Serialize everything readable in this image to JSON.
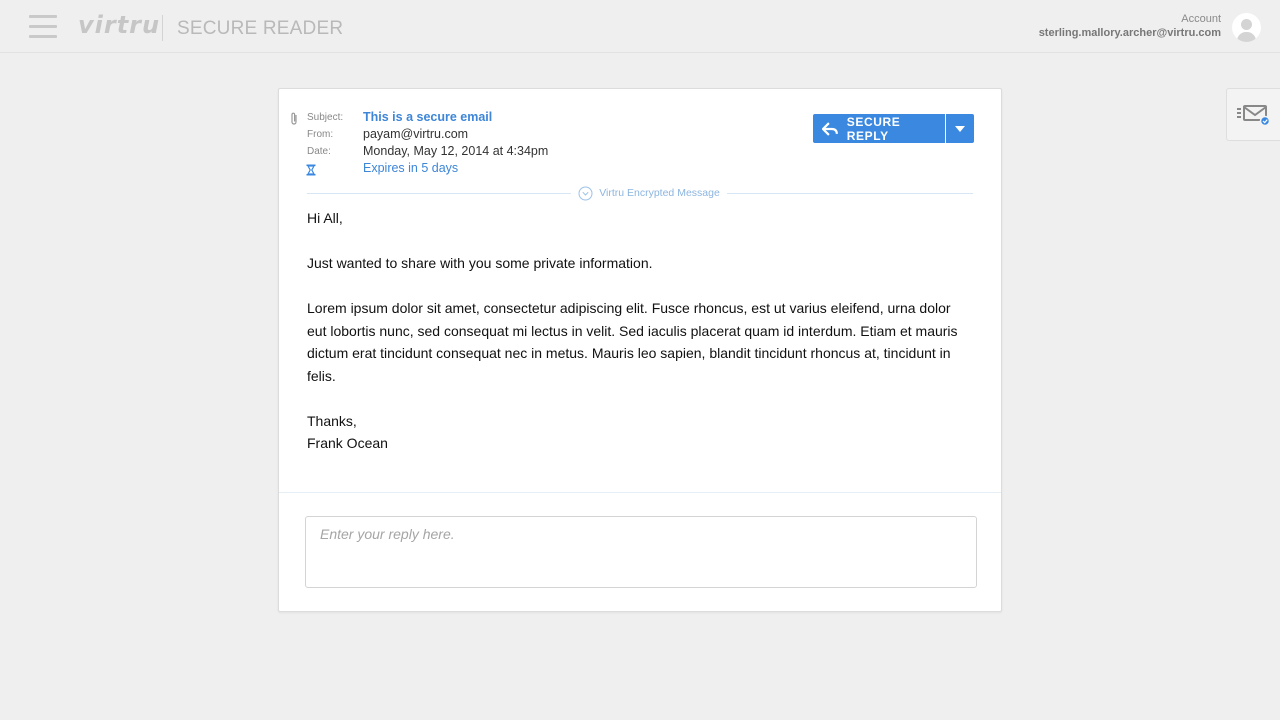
{
  "header": {
    "brand": "virtru",
    "product": "SECURE READER",
    "account_label": "Account",
    "account_email": "sterling.mallory.archer@virtru.com"
  },
  "message": {
    "labels": {
      "subject": "Subject:",
      "from": "From:",
      "date": "Date:"
    },
    "subject": "This is a secure email",
    "from": "payam@virtru.com",
    "date": "Monday, May 12, 2014 at 4:34pm",
    "expires": "Expires in 5 days",
    "encrypted_label": "Virtru Encrypted Message",
    "body": {
      "greeting": "Hi All,",
      "line1": "Just wanted to share with you some private information.",
      "paragraph": "Lorem ipsum dolor sit amet, consectetur adipiscing elit. Fusce rhoncus, est ut varius eleifend, urna dolor eut lobortis nunc, sed consequat mi lectus in velit. Sed iaculis placerat quam id interdum. Etiam et mauris dictum erat tincidunt consequat nec in metus. Mauris leo sapien, blandit tincidunt rhoncus at, tincidunt in felis.",
      "closing": "Thanks,",
      "signature": "Frank Ocean"
    }
  },
  "actions": {
    "secure_reply": "SECURE REPLY"
  },
  "reply": {
    "placeholder": "Enter your reply here.",
    "value": ""
  },
  "colors": {
    "accent": "#3a88e0",
    "link": "#3d86d8",
    "background": "#efefef"
  },
  "icons": [
    "menu-icon",
    "paperclip-icon",
    "hourglass-icon",
    "reply-arrow-icon",
    "chevron-down-icon",
    "shield-icon",
    "user-avatar-icon",
    "inbox-envelope-icon"
  ]
}
